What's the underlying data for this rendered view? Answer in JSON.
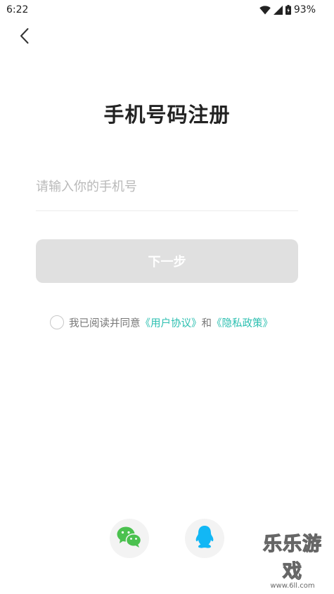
{
  "status_bar": {
    "time": "6:22",
    "battery": "93%",
    "icons": [
      "wifi-icon",
      "cell-signal-icon",
      "battery-icon"
    ]
  },
  "header": {
    "back_icon": "chevron-left-icon"
  },
  "title": "手机号码注册",
  "phone_input": {
    "value": "",
    "placeholder": "请输入你的手机号"
  },
  "next_button": {
    "label": "下一步"
  },
  "agreement": {
    "prefix": "我已阅读并同意",
    "user_agreement": "《用户协议》",
    "and": "和",
    "privacy_policy": "《隐私政策》",
    "checked": false
  },
  "social_login": [
    {
      "name": "WeChat",
      "icon": "wechat-icon"
    },
    {
      "name": "QQ",
      "icon": "qq-icon"
    }
  ],
  "watermark": {
    "title": "乐乐游戏",
    "url": "www.6ll.com"
  },
  "colors": {
    "accent": "#2bbfb0",
    "button_disabled": "#e0e0e0",
    "wechat": "#4bc14f",
    "qq": "#12b7f5"
  }
}
